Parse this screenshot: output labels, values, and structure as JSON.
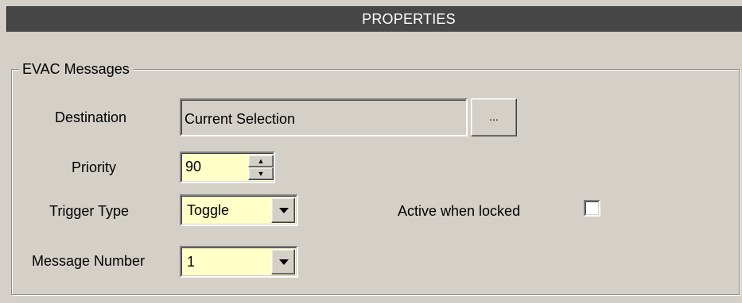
{
  "header": {
    "title": "PROPERTIES"
  },
  "group": {
    "title": "EVAC Messages"
  },
  "fields": {
    "destination": {
      "label": "Destination",
      "value": "Current Selection",
      "browse_label": "..."
    },
    "priority": {
      "label": "Priority",
      "value": "90"
    },
    "trigger_type": {
      "label": "Trigger Type",
      "value": "Toggle"
    },
    "active_when_locked": {
      "label": "Active when locked",
      "checked": false
    },
    "message_number": {
      "label": "Message Number",
      "value": "1"
    }
  },
  "icons": {
    "spin_up": "up-arrow-icon",
    "spin_down": "down-arrow-icon",
    "dropdown": "chevron-down-icon"
  },
  "colors": {
    "header_bg": "#474747",
    "panel_bg": "#d4d0c8",
    "input_bg": "#ffffc8"
  }
}
